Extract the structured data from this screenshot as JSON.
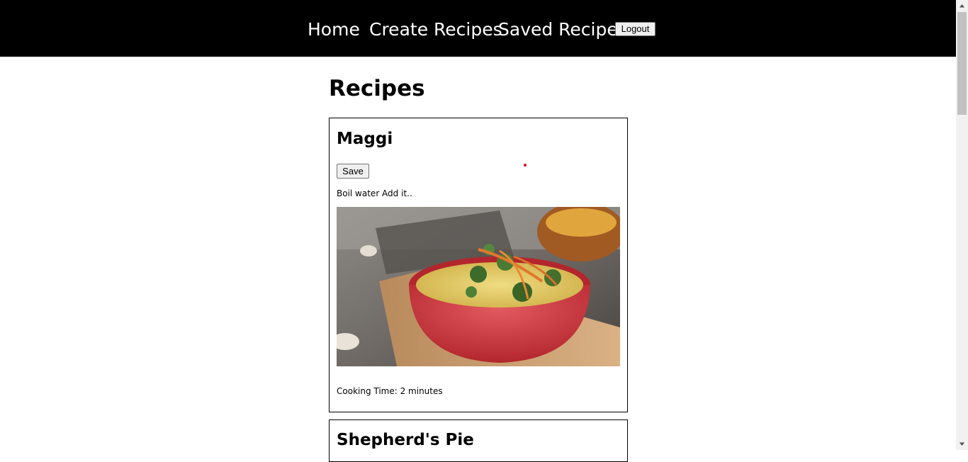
{
  "nav": {
    "home": "Home",
    "create": "Create Recipes",
    "saved": "Saved Recipes",
    "logout": "Logout"
  },
  "page": {
    "title": "Recipes"
  },
  "recipes": [
    {
      "name": "Maggi",
      "save_label": "Save",
      "instructions": "Boil water Add it..",
      "image": "bowl of noodles with broccoli and carrot",
      "cooking_time": "Cooking Time: 2 minutes"
    },
    {
      "name": "Shepherd's Pie"
    }
  ],
  "colors": {
    "navbar": "#000000",
    "background": "#ffffff",
    "bowl": "#d9434a",
    "noodles": "#e2c95a"
  }
}
